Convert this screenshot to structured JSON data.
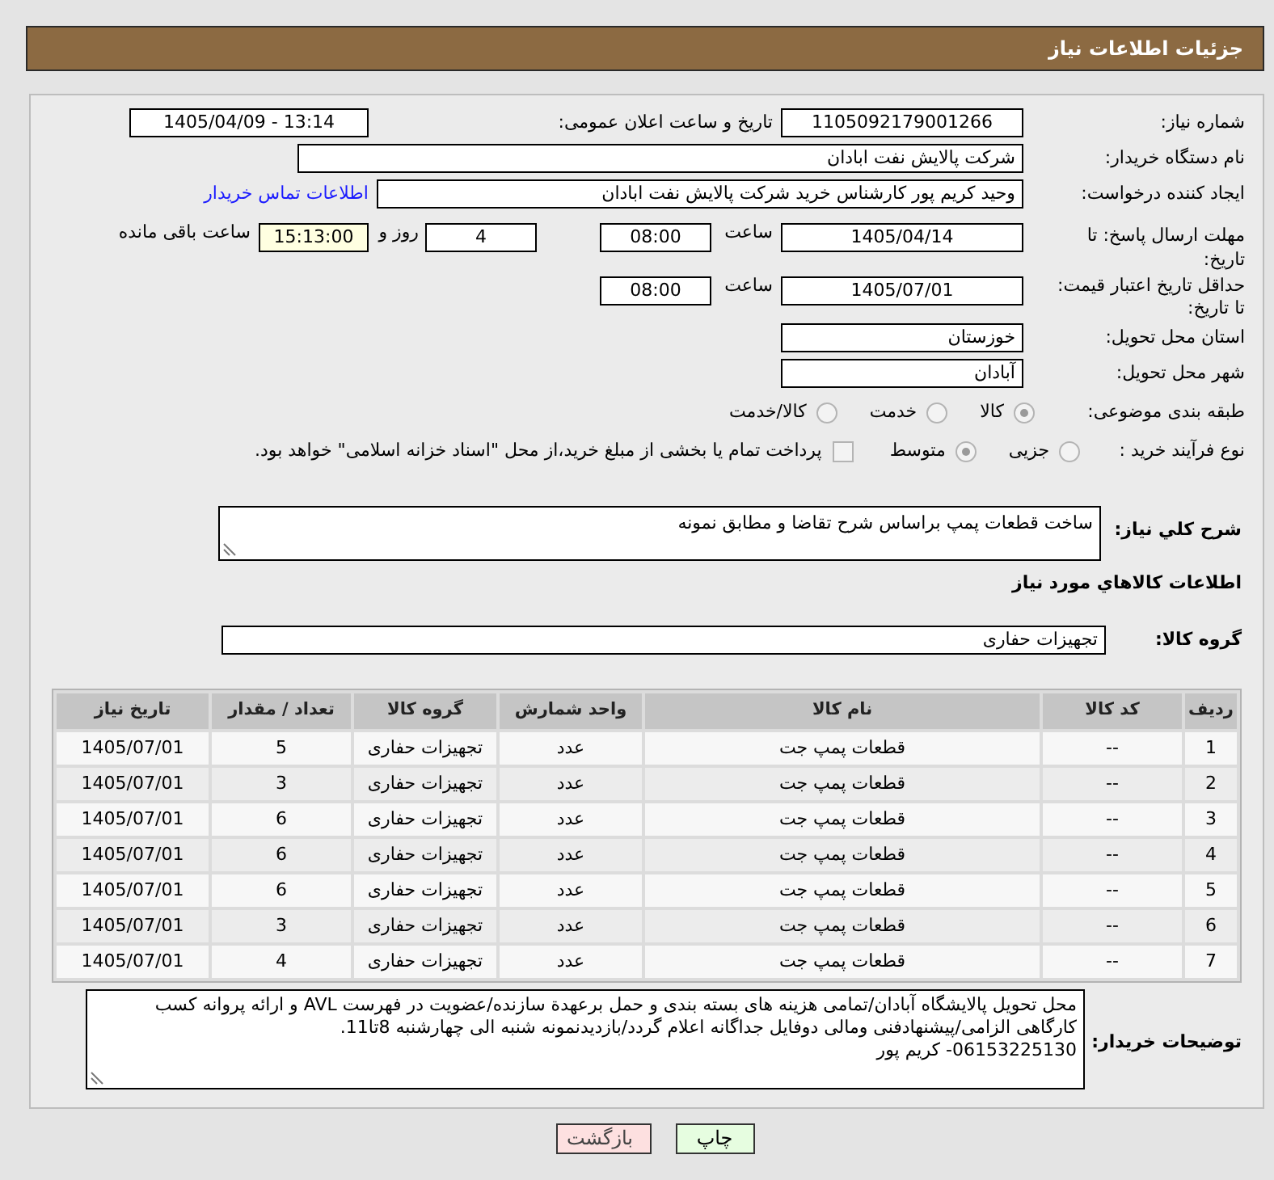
{
  "header": {
    "title": "جزئیات اطلاعات نیاز"
  },
  "need_number": {
    "label": "شماره نیاز:",
    "value": "1105092179001266"
  },
  "announcement": {
    "label": "تاریخ و ساعت اعلان عمومی:",
    "value": "1405/04/09 - 13:14"
  },
  "buyer_org": {
    "label": "نام دستگاه خریدار:",
    "value": "شرکت پالایش نفت ابادان"
  },
  "requester": {
    "label": "ایجاد کننده درخواست:",
    "value": "وحید کریم پور کارشناس خرید  شرکت پالایش نفت ابادان",
    "link": "اطلاعات تماس خریدار"
  },
  "response_deadline": {
    "label": "مهلت ارسال پاسخ: تا تاریخ:",
    "date": "1405/04/14",
    "time_label": "ساعت",
    "time": "08:00",
    "days": "4",
    "days_label": "روز و",
    "remaining": "15:13:00",
    "remaining_label": "ساعت باقی مانده"
  },
  "price_validity": {
    "label": "حداقل تاریخ اعتبار قیمت: تا تاریخ:",
    "date": "1405/07/01",
    "time_label": "ساعت",
    "time": "08:00"
  },
  "province": {
    "label": "استان محل تحویل:",
    "value": "خوزستان"
  },
  "city": {
    "label": "شهر محل تحویل:",
    "value": "آبادان"
  },
  "category": {
    "label": "طبقه بندی موضوعی:",
    "options": [
      {
        "label": "کالا",
        "selected": true
      },
      {
        "label": "خدمت",
        "selected": false
      },
      {
        "label": "کالا/خدمت",
        "selected": false
      }
    ]
  },
  "purchase_process": {
    "label": "نوع فرآیند خرید :",
    "options": [
      {
        "label": "جزیی",
        "selected": false
      },
      {
        "label": "متوسط",
        "selected": true
      }
    ],
    "treasury": {
      "label": "پرداخت تمام یا بخشی از مبلغ خرید،از محل \"اسناد خزانه اسلامی\" خواهد بود.",
      "checked": false
    }
  },
  "description": {
    "label": "شرح کلي نياز:",
    "value": "ساخت قطعات پمپ براساس شرح تقاضا و مطابق نمونه"
  },
  "items_section": {
    "title": "اطلاعات کالاهاي مورد نياز"
  },
  "goods_group": {
    "label": "گروه کالا:",
    "value": "تجهیزات حفاری"
  },
  "table": {
    "columns": [
      "ردیف",
      "کد کالا",
      "نام کالا",
      "واحد شمارش",
      "گروه کالا",
      "تعداد / مقدار",
      "تاریخ نیاز"
    ],
    "rows": [
      [
        "1",
        "--",
        "قطعات پمپ جت",
        "عدد",
        "تجهیزات حفاری",
        "5",
        "1405/07/01"
      ],
      [
        "2",
        "--",
        "قطعات پمپ جت",
        "عدد",
        "تجهیزات حفاری",
        "3",
        "1405/07/01"
      ],
      [
        "3",
        "--",
        "قطعات پمپ جت",
        "عدد",
        "تجهیزات حفاری",
        "6",
        "1405/07/01"
      ],
      [
        "4",
        "--",
        "قطعات پمپ جت",
        "عدد",
        "تجهیزات حفاری",
        "6",
        "1405/07/01"
      ],
      [
        "5",
        "--",
        "قطعات پمپ جت",
        "عدد",
        "تجهیزات حفاری",
        "6",
        "1405/07/01"
      ],
      [
        "6",
        "--",
        "قطعات پمپ جت",
        "عدد",
        "تجهیزات حفاری",
        "3",
        "1405/07/01"
      ],
      [
        "7",
        "--",
        "قطعات پمپ جت",
        "عدد",
        "تجهیزات حفاری",
        "4",
        "1405/07/01"
      ]
    ]
  },
  "buyer_notes": {
    "label": "توضیحات خریدار:",
    "value": "محل تحویل پالایشگاه آبادان/تمامی هزینه های بسته بندی و حمل برعهدة سازنده/عضویت در فهرست AVL و ارائه پروانه کسب کارگاهی الزامی/پیشنهادفنی ومالی دوفایل جداگانه اعلام گردد/بازدیدنمونه شنبه الی چهارشنبه 8تا11.\n06153225130- کریم پور"
  },
  "buttons": [
    {
      "label": "چاپ",
      "kind": "print"
    },
    {
      "label": "بازگشت",
      "kind": "back"
    }
  ]
}
